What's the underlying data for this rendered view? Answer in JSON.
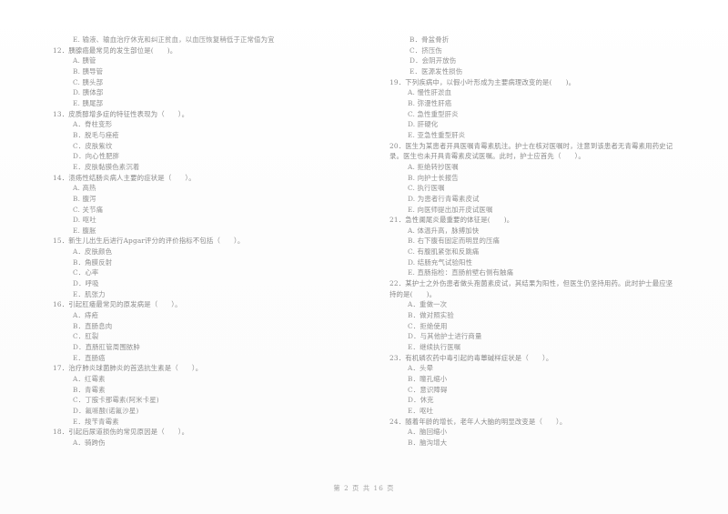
{
  "document": {
    "type": "exam-paper",
    "page_footer": "第 2 页  共 16 页"
  },
  "left_column": {
    "carry_over_option": "E. 输液、输血治疗休克和纠正贫血，以血压恢复稍低于正常值为宜",
    "questions": [
      {
        "stem": "12．胰腺癌最常见的发生部位是(      )。",
        "options": [
          "A. 胰管",
          "B. 胰导管",
          "C. 胰头部",
          "D. 胰体部",
          "E. 胰尾部"
        ]
      },
      {
        "stem": "13．皮质醇增多症的特征性表现为（      ）。",
        "options": [
          "A．脊柱变形",
          "B．脱毛与痤疮",
          "C．皮肤紫纹",
          "D．向心性肥胖",
          "E．皮肤黏膜色素沉着"
        ]
      },
      {
        "stem": "14．溃疡性结肠炎病人主要的症状是（      ）。",
        "options": [
          "A. 高热",
          "B. 腹泻",
          "C. 关节痛",
          "D. 呕吐",
          "E. 腹胀"
        ]
      },
      {
        "stem": "15．新生儿出生后进行Apgar评分的评价指标不包括（      ）。",
        "options": [
          "A．皮肤颜色",
          "B．角膜反射",
          "C．心率",
          "D．呼吸",
          "E．肌张力"
        ]
      },
      {
        "stem": "16．引起肛瘘最常见的原发病是（      ）。",
        "options": [
          "A．痔疮",
          "B．直肠息肉",
          "C．肛裂",
          "D．直肠肛管周围脓肿",
          "E．直肠癌"
        ]
      },
      {
        "stem": "17．治疗肺炎球菌肺炎的首选抗生素是（      ）。",
        "options": [
          "A．红霉素",
          "B．青霉素",
          "C．丁胺卡那霉素(阿米卡星)",
          "D．氟哌酸(诺氟沙星)",
          "E．羧苄青霉素"
        ]
      },
      {
        "stem": "18．引起后尿道损伤的常见原因是（      ）。",
        "options": [
          "A．骑跨伤"
        ]
      }
    ]
  },
  "right_column": {
    "carry_over_options": [
      "B．骨盆骨折",
      "C．挤压伤",
      "D．会阴开放伤",
      "E．医源发性损伤"
    ],
    "questions": [
      {
        "stem": "19．下列疾病中，以假小叶形成为主要病理改变的是(      )。",
        "options": [
          "A. 慢性肝淤血",
          "B. 弥漫性肝癌",
          "C. 急性重型肝炎",
          "D. 肝硬化",
          "E. 亚急性重型肝炎"
        ]
      },
      {
        "stem": "20．医生为某患者开具医嘱青霉素肌注。护士在核对医嘱时，注意到该患者无青霉素用药史记",
        "stem_cont": "录。医生也未开具青霉素皮试医嘱。此时，护士应首先（      ）。",
        "options": [
          "A. 拒绝转抄医嘱",
          "B. 向护士长报告",
          "C. 执行医嘱",
          "D. 为患者行青霉素皮试",
          "E. 向医师提出加开皮试医嘱"
        ]
      },
      {
        "stem": "21．急性阑尾炎最重要的体征是(      )。",
        "options": [
          "A. 体温升高，脉搏加快",
          "B. 右下腹有固定而明显的压痛",
          "C. 有腹肌紧张和反跳痛",
          "D. 结肠充气试验阳性",
          "E. 直肠指检：直肠前壁右侧有触痛"
        ]
      },
      {
        "stem": "22．某护士之外伤患者做头孢菌素皮试，其结果为阳性，但医生仍坚持用药。此时护士最应坚",
        "stem_cont": "持的是(      )。",
        "options": [
          "A．重做一次",
          "B．做对照实验",
          "C．拒绝使用",
          "D．与其他护士进行商量",
          "E．继续执行医嘱"
        ]
      },
      {
        "stem": "23．有机磷农药中毒引起的毒蕈碱样症状是（      ）。",
        "options": [
          "A．头晕",
          "B．瞳孔缩小",
          "C．意识障碍",
          "D．休克",
          "E．呕吐"
        ]
      },
      {
        "stem": "24．随着年龄的增长，老年人大脑的明显改变是（      ）。",
        "options": [
          "A．脑回缩小",
          "B．脑沟增大"
        ]
      }
    ]
  }
}
